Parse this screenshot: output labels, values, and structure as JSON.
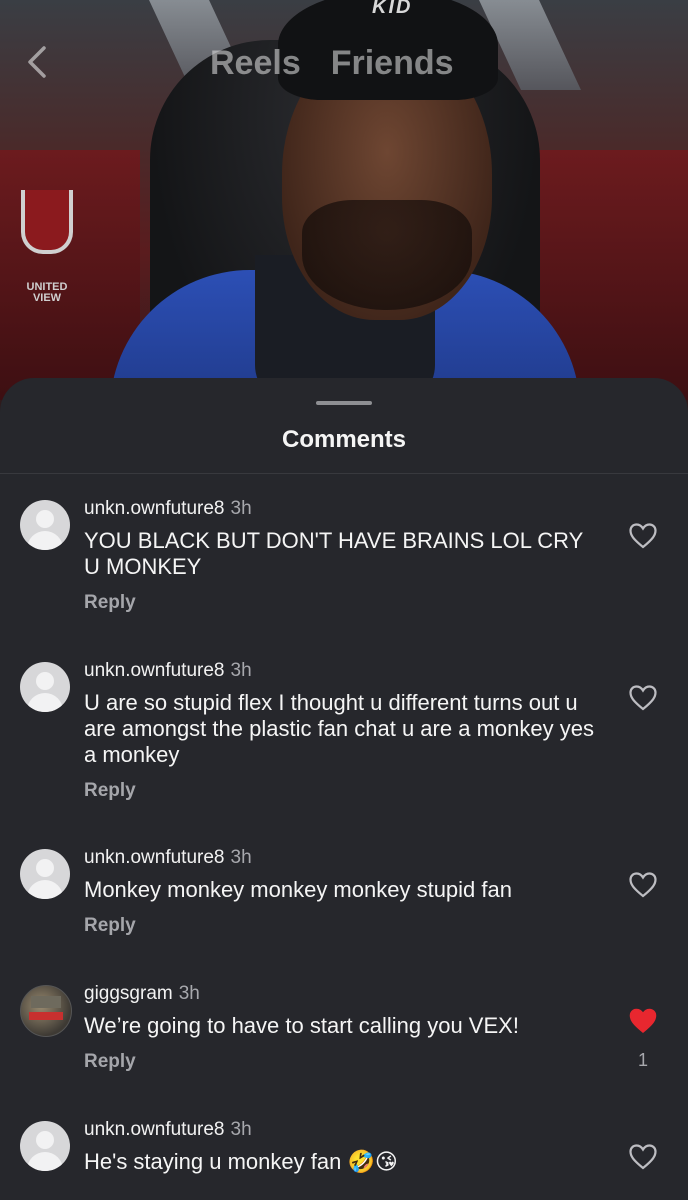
{
  "header": {
    "tabs": [
      {
        "label": "Reels"
      },
      {
        "label": "Friends"
      }
    ],
    "back_icon": "chevron-left-icon"
  },
  "video": {
    "cap_text": "KID",
    "logo_text_line1": "UNITED",
    "logo_text_line2": "VIEW"
  },
  "sheet": {
    "title": "Comments"
  },
  "colors": {
    "sheet_bg": "#26272c",
    "liked_heart": "#e8272f",
    "muted_text": "#a7a8ad"
  },
  "comments": [
    {
      "username": "unkn.ownfuture8",
      "time": "3h",
      "text": "YOU BLACK BUT DON'T HAVE BRAINS LOL CRY U MONKEY",
      "reply_label": "Reply",
      "liked": false,
      "avatar": "default"
    },
    {
      "username": "unkn.ownfuture8",
      "time": "3h",
      "text": "U are so stupid flex I thought u different turns out u are amongst the plastic fan chat u are a monkey yes a monkey",
      "reply_label": "Reply",
      "liked": false,
      "avatar": "default"
    },
    {
      "username": "unkn.ownfuture8",
      "time": "3h",
      "text": "Monkey monkey monkey monkey stupid fan",
      "reply_label": "Reply",
      "liked": false,
      "avatar": "default"
    },
    {
      "username": "giggsgram",
      "time": "3h",
      "text": "We’re going to have to start calling you VEX!",
      "reply_label": "Reply",
      "liked": true,
      "like_count": "1",
      "avatar": "photo"
    },
    {
      "username": "unkn.ownfuture8",
      "time": "3h",
      "text": "He's staying u monkey fan 🤣😘",
      "reply_label": "",
      "liked": false,
      "avatar": "default"
    }
  ]
}
